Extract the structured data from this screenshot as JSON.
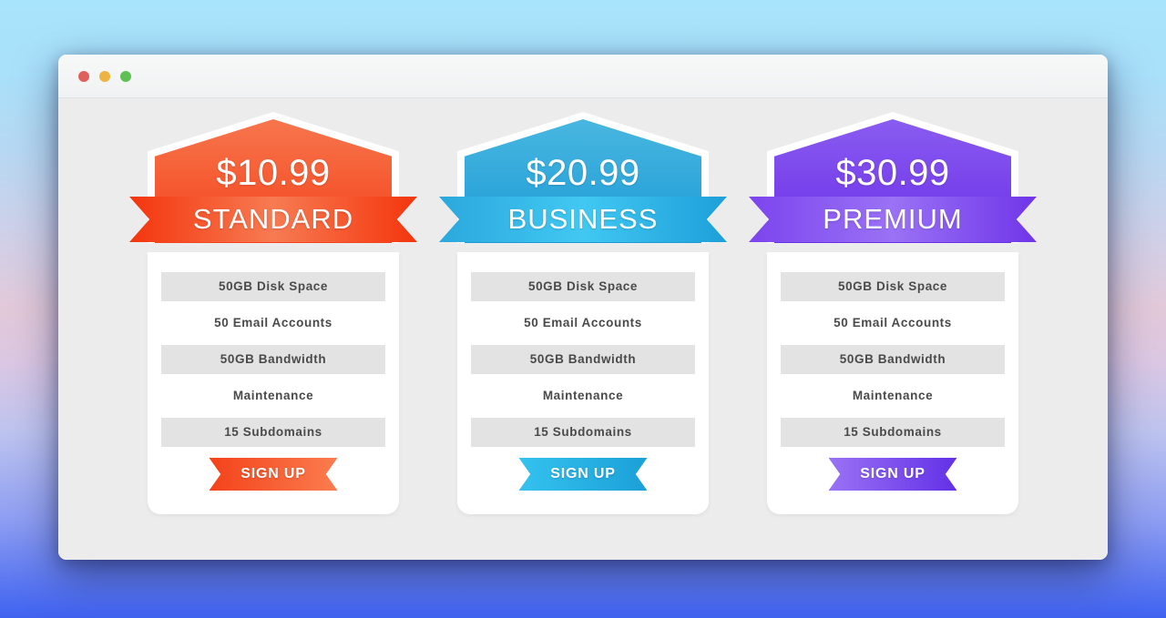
{
  "window": {
    "traffic_lights": [
      {
        "name": "close-dot",
        "color": "#e0605c"
      },
      {
        "name": "minimize-dot",
        "color": "#eeb340"
      },
      {
        "name": "maximize-dot",
        "color": "#5fc054"
      }
    ]
  },
  "pricing": {
    "signup_label": "SIGN UP",
    "plans": [
      {
        "id": "standard",
        "price": "$10.99",
        "name": "STANDARD",
        "features": [
          "50GB Disk Space",
          "50 Email Accounts",
          "50GB Bandwidth",
          "Maintenance",
          "15 Subdomains"
        ],
        "colors": {
          "header_top": "#f7764d",
          "header_bottom": "#f4421a",
          "ribbon_left": "#f4350d",
          "ribbon_mid": "#f77b52",
          "ribbon_right": "#f4350d",
          "button_left": "#f4421a",
          "button_right": "#fb7d4f"
        }
      },
      {
        "id": "business",
        "price": "$20.99",
        "name": "BUSINESS",
        "features": [
          "50GB Disk Space",
          "50 Email Accounts",
          "50GB Bandwidth",
          "Maintenance",
          "15 Subdomains"
        ],
        "colors": {
          "header_top": "#49b7e0",
          "header_bottom": "#1b9ad6",
          "ribbon_left": "#2ba8dd",
          "ribbon_mid": "#41c8f2",
          "ribbon_right": "#1d9fd9",
          "button_left": "#34c2ef",
          "button_right": "#1ba0d8"
        }
      },
      {
        "id": "premium",
        "price": "$30.99",
        "name": "PREMIUM",
        "features": [
          "50GB Disk Space",
          "50 Email Accounts",
          "50GB Bandwidth",
          "Maintenance",
          "15 Subdomains"
        ],
        "colors": {
          "header_top": "#8a5cf0",
          "header_bottom": "#6a2fe8",
          "ribbon_left": "#7c44ee",
          "ribbon_mid": "#9a72f5",
          "ribbon_right": "#6f35e9",
          "button_left": "#9a72f5",
          "button_right": "#6230e7"
        }
      }
    ]
  }
}
